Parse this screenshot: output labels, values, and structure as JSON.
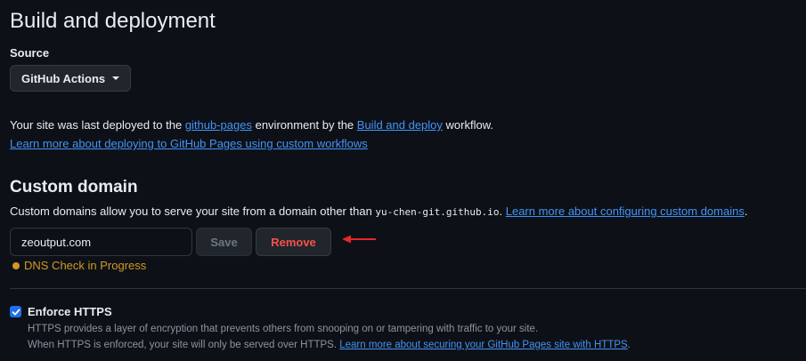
{
  "section_title": "Build and deployment",
  "source": {
    "label": "Source",
    "selected": "GitHub Actions"
  },
  "deploy_info": {
    "prefix": "Your site was last deployed to the ",
    "environment_link": "github-pages",
    "middle": " environment by the ",
    "workflow_link": "Build and deploy",
    "suffix": " workflow.",
    "learn_more_link": "Learn more about deploying to GitHub Pages using custom workflows"
  },
  "custom_domain": {
    "title": "Custom domain",
    "description_prefix": "Custom domains allow you to serve your site from a domain other than ",
    "default_domain": "yu-chen-git.github.io",
    "description_suffix": ". ",
    "learn_more_link": "Learn more about configuring custom domains",
    "learn_more_suffix": ".",
    "input_value": "zeoutput.com",
    "save_label": "Save",
    "remove_label": "Remove",
    "dns_status": "DNS Check in Progress"
  },
  "https": {
    "label": "Enforce HTTPS",
    "checked": true,
    "line1": "HTTPS provides a layer of encryption that prevents others from snooping on or tampering with traffic to your site.",
    "line2_prefix": "When HTTPS is enforced, your site will only be served over HTTPS. ",
    "learn_more_link": "Learn more about securing your GitHub Pages site with HTTPS",
    "line2_suffix": "."
  },
  "colors": {
    "background": "#0d1117",
    "link": "#4493f8",
    "danger": "#f85149",
    "warning": "#d29922",
    "annotation_arrow": "#e5282b",
    "checkbox": "#1f6feb"
  },
  "icons": {
    "dropdown": "caret-down-icon",
    "annotation": "red-arrow-icon",
    "status": "dot-icon",
    "checkbox": "checkmark-icon"
  }
}
